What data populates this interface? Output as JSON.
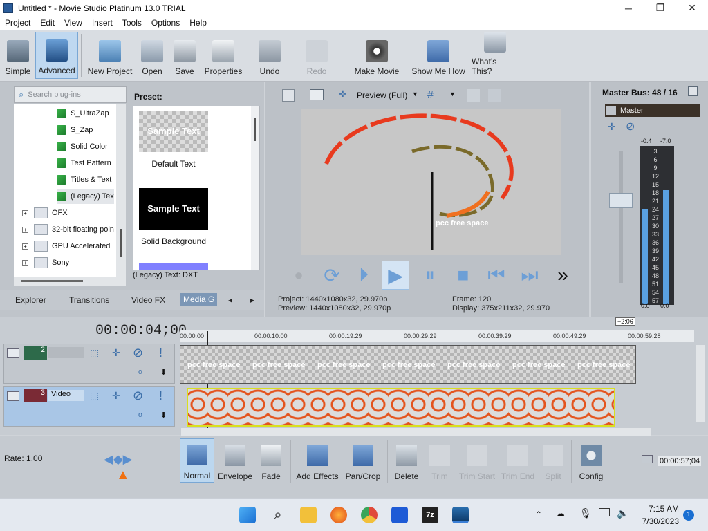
{
  "window": {
    "title": "Untitled * - Movie Studio Platinum 13.0 TRIAL",
    "minimize": "─",
    "maximize": "❐",
    "close": "✕"
  },
  "menu": [
    "Project",
    "Edit",
    "View",
    "Insert",
    "Tools",
    "Options",
    "Help"
  ],
  "toolbar": {
    "simple": "Simple",
    "advanced": "Advanced",
    "new_project": "New Project",
    "open": "Open",
    "save": "Save",
    "properties": "Properties",
    "undo": "Undo",
    "redo": "Redo",
    "make_movie": "Make Movie",
    "show_me_how": "Show Me How",
    "whats_this": "What's This?"
  },
  "explorer": {
    "search_placeholder": "Search plug-ins",
    "tree": [
      "S_UltraZap",
      "S_Zap",
      "Solid Color",
      "Test Pattern",
      "Titles & Text",
      "(Legacy) Tex",
      "OFX",
      "32-bit floating poin",
      "GPU Accelerated",
      "Sony"
    ],
    "preset_label": "Preset:",
    "presets": [
      {
        "thumb": "Sample Text",
        "label": "Default Text"
      },
      {
        "thumb": "Sample Text",
        "label": "Solid Background"
      }
    ],
    "status": "(Legacy) Text: DXT",
    "tabs": [
      "Explorer",
      "Transitions",
      "Video FX",
      "Media G"
    ]
  },
  "preview": {
    "mode": "Preview (Full)",
    "overlay_text": "pcc free space",
    "project_label": "Project:",
    "project_value": "1440x1080x32, 29.970p",
    "preview_label": "Preview:",
    "preview_value": "1440x1080x32, 29.970p",
    "frame_label": "Frame:",
    "frame_value": "120",
    "display_label": "Display:",
    "display_value": "375x211x32, 29.970"
  },
  "master": {
    "title": "Master Bus: 48 / 16",
    "bus_name": "Master",
    "peak_left": "-0.4",
    "peak_right": "-7.0",
    "scale": [
      "3",
      "6",
      "9",
      "12",
      "15",
      "18",
      "21",
      "24",
      "27",
      "30",
      "33",
      "36",
      "39",
      "42",
      "45",
      "48",
      "51",
      "54",
      "57"
    ],
    "bottom_left": "0.0",
    "bottom_right": "0.0",
    "level_left": 0.6,
    "level_right": 0.72
  },
  "timeline": {
    "timecode": "00:00:04;00",
    "end_marker": "+2:06",
    "ruler": [
      "00:00:00",
      "00:00:10:00",
      "00:00:19:29",
      "00:00:29:29",
      "00:00:39:29",
      "00:00:49:29",
      "00:00:59:28"
    ],
    "tracks": [
      {
        "number": "2",
        "name": ""
      },
      {
        "number": "3",
        "name": "Video"
      }
    ],
    "clip_text": "pcc free space",
    "rate_label": "Rate: 1.00"
  },
  "tools": {
    "normal": "Normal",
    "envelope": "Envelope",
    "fade": "Fade",
    "add_effects": "Add Effects",
    "pan_crop": "Pan/Crop",
    "delete": "Delete",
    "trim": "Trim",
    "trim_start": "Trim Start",
    "trim_end": "Trim End",
    "split": "Split",
    "config": "Config",
    "duration": "00:00:57;04"
  },
  "taskbar": {
    "time": "7:15 AM",
    "date": "7/30/2023",
    "notifications": "1"
  }
}
